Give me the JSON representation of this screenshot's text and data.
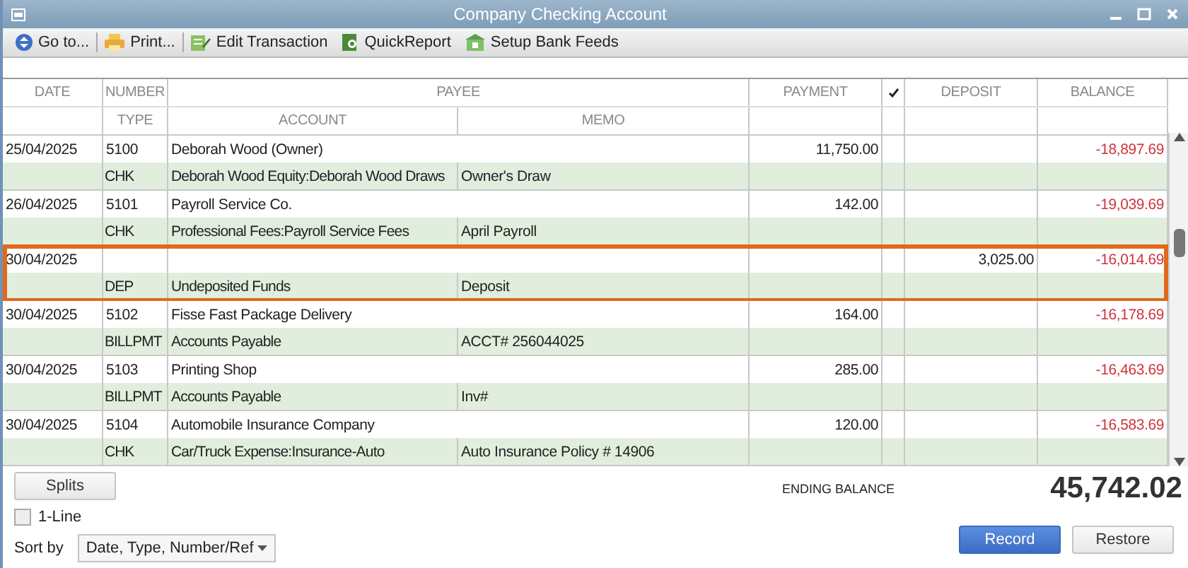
{
  "window": {
    "title": "Company Checking Account"
  },
  "toolbar": [
    {
      "label": "Go to..."
    },
    {
      "label": "Print..."
    },
    {
      "label": "Edit Transaction"
    },
    {
      "label": "QuickReport"
    },
    {
      "label": "Setup Bank Feeds"
    }
  ],
  "register": {
    "header_top": {
      "date": "DATE",
      "number": "NUMBER",
      "payee": "PAYEE",
      "payment": "PAYMENT",
      "deposit": "DEPOSIT",
      "balance": "BALANCE"
    },
    "header_bottom": {
      "type": "TYPE",
      "account": "ACCOUNT",
      "memo": "MEMO"
    },
    "transactions": [
      {
        "date": "25/04/2025",
        "number": "5100",
        "payee": "Deborah Wood (Owner)",
        "payment": "11,750.00",
        "balance": "-18,897.69",
        "type": "CHK",
        "account": "Deborah Wood Equity:Deborah Wood Draws",
        "memo": "Owner's Draw",
        "highlighted": false
      },
      {
        "date": "26/04/2025",
        "number": "5101",
        "payee": "Payroll Service Co.",
        "payment": "142.00",
        "balance": "-19,039.69",
        "type": "CHK",
        "account": "Professional Fees:Payroll Service Fees",
        "memo": "April Payroll",
        "highlighted": false
      },
      {
        "date": "30/04/2025",
        "deposit": "3,025.00",
        "balance": "-16,014.69",
        "type": "DEP",
        "account": "Undeposited Funds",
        "memo": "Deposit",
        "highlighted": true
      },
      {
        "date": "30/04/2025",
        "number": "5102",
        "payee": "Fisse Fast Package Delivery",
        "payment": "164.00",
        "balance": "-16,178.69",
        "type": "BILLPMT",
        "account": "Accounts Payable",
        "memo": "ACCT# 256044025",
        "highlighted": false
      },
      {
        "date": "30/04/2025",
        "number": "5103",
        "payee": "Printing Shop",
        "payment": "285.00",
        "balance": "-16,463.69",
        "type": "BILLPMT",
        "account": "Accounts Payable",
        "memo": "Inv#",
        "highlighted": false
      },
      {
        "date": "30/04/2025",
        "number": "5104",
        "payee": "Automobile Insurance Company",
        "payment": "120.00",
        "balance": "-16,583.69",
        "type": "CHK",
        "account": "Car/Truck Expense:Insurance-Auto",
        "memo": "Auto Insurance Policy # 14906",
        "highlighted": false
      }
    ]
  },
  "footer": {
    "splits_button": "Splits",
    "one_line": {
      "label": "1-Line",
      "checked": false
    },
    "sort_by": {
      "label": "Sort by",
      "value": "Date, Type, Number/Ref"
    },
    "ending_balance": {
      "label": "ENDING BALANCE",
      "value": "45,742.02"
    },
    "buttons": [
      {
        "label": "Record",
        "primary": true
      },
      {
        "label": "Restore",
        "primary": false
      }
    ]
  }
}
